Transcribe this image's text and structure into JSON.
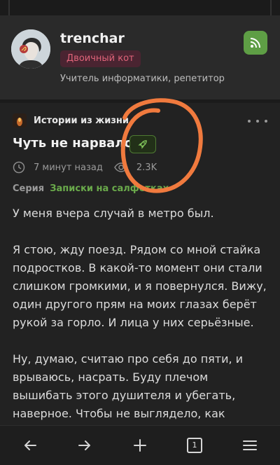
{
  "profile": {
    "username": "trenchar",
    "badge": "Двоичный кот",
    "bio": "Учитель информатики, репетитор"
  },
  "post": {
    "community": "Истории из жизни",
    "title": "Чуть не нарвался",
    "read_time": "7 минут назад",
    "views": "2.3K",
    "series_label": "Серия",
    "series_name": "Записки на салфетках",
    "paragraphs": [
      "У меня вчера случай в метро был.",
      "Я стою, жду поезд. Рядом со мной стайка подростков. В какой-то момент они стали слишком громкими, и я повернулся. Вижу, один другого прям на моих глазах берёт рукой за горло. И лица у них серьёзные.",
      "Ну, думаю, считаю про себя до пяти, и врываюсь, насрать. Буду плечом вышибать этого душителя и убегать, наверное. Чтобы не выглядело, как драка."
    ]
  },
  "nav": {
    "tab_count": "1"
  },
  "colors": {
    "background": "#222222",
    "accent_green": "#6aaa4b",
    "badge_text": "#e0647a",
    "annotation": "#f07a3e"
  },
  "icons": [
    "rss-icon",
    "rocket-icon",
    "clock-icon",
    "eye-icon",
    "more-icon",
    "back-arrow-icon",
    "forward-arrow-icon",
    "plus-icon",
    "tabs-icon",
    "menu-icon"
  ]
}
